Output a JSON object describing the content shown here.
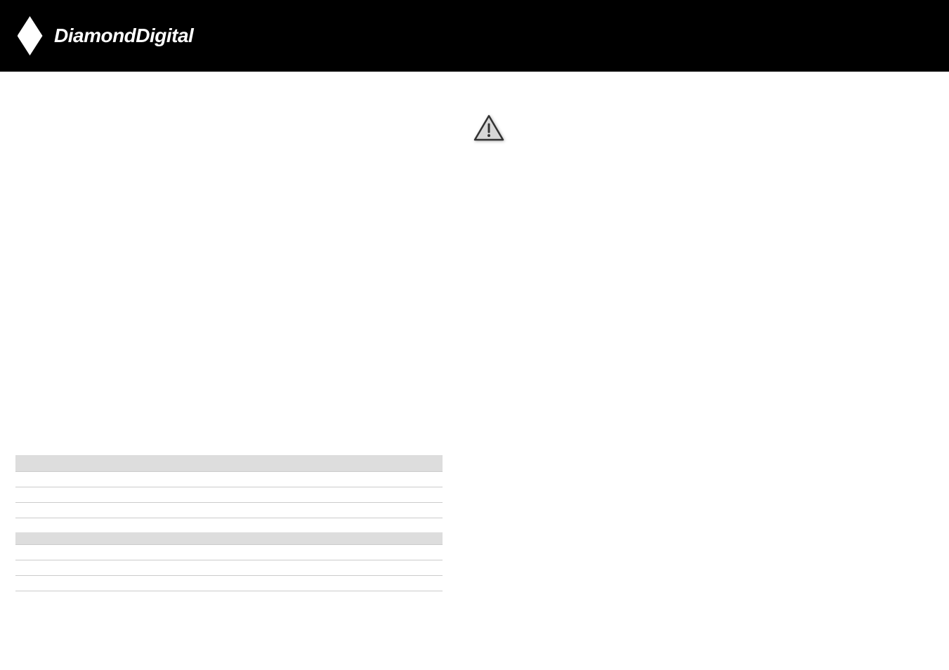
{
  "header": {
    "brand": "DiamondDigital"
  },
  "warning": {
    "icon_name": "warning-triangle"
  },
  "table": {
    "rows": [
      {
        "shaded": true
      },
      {
        "shaded": false
      },
      {
        "shaded": false
      },
      {
        "shaded": false
      },
      {
        "shaded": true
      },
      {
        "shaded": false
      },
      {
        "shaded": false
      },
      {
        "shaded": false
      }
    ]
  }
}
